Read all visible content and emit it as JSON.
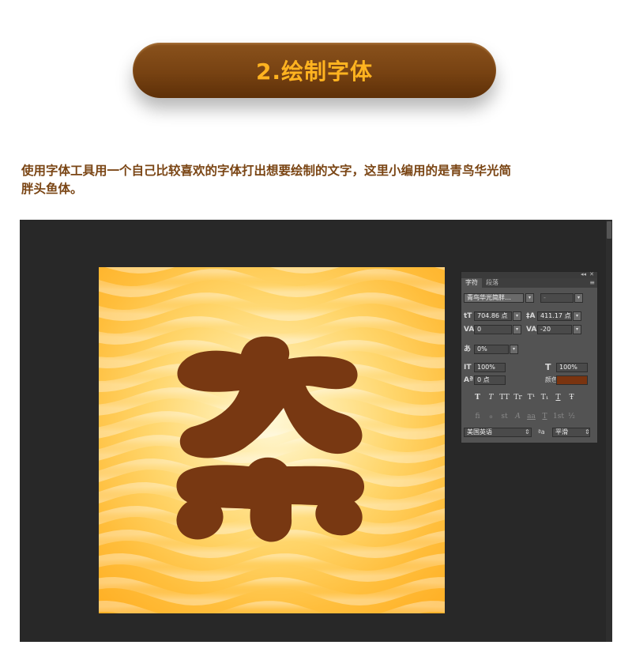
{
  "header": {
    "title": "2.绘制字体"
  },
  "description": {
    "line1": "使用字体工具用一个自己比较喜欢的字体打出想要绘制的文字，这里小编用的是青鸟华光简",
    "line2": "胖头鱼体。"
  },
  "canvas": {
    "glyph_color": "#783812",
    "background_colors": [
      "#fff8d6",
      "#ffd56a",
      "#ffae22"
    ]
  },
  "character_panel": {
    "tabs": [
      {
        "label": "字符",
        "active": true
      },
      {
        "label": "段落",
        "active": false
      }
    ],
    "font_family": "青鸟华光简胖…",
    "font_style": "-",
    "font_size": "704.86 点",
    "leading": "411.17 点",
    "kerning": "0",
    "tracking": "-20",
    "tsume": "0%",
    "vertical_scale": "100%",
    "horizontal_scale": "100%",
    "baseline_shift": "0 点",
    "color_label": "颜色:",
    "text_color": "#7a3410",
    "style_buttons": [
      "T",
      "T",
      "TT",
      "Tr",
      "T¹",
      "T₁",
      "T",
      "Ŧ"
    ],
    "opentype_buttons": [
      "fi",
      "ℴ",
      "st",
      "A",
      "aa",
      "T",
      "1st",
      "½"
    ],
    "language": "美国英语",
    "aa_label": "ªa",
    "antialias": "平滑"
  }
}
